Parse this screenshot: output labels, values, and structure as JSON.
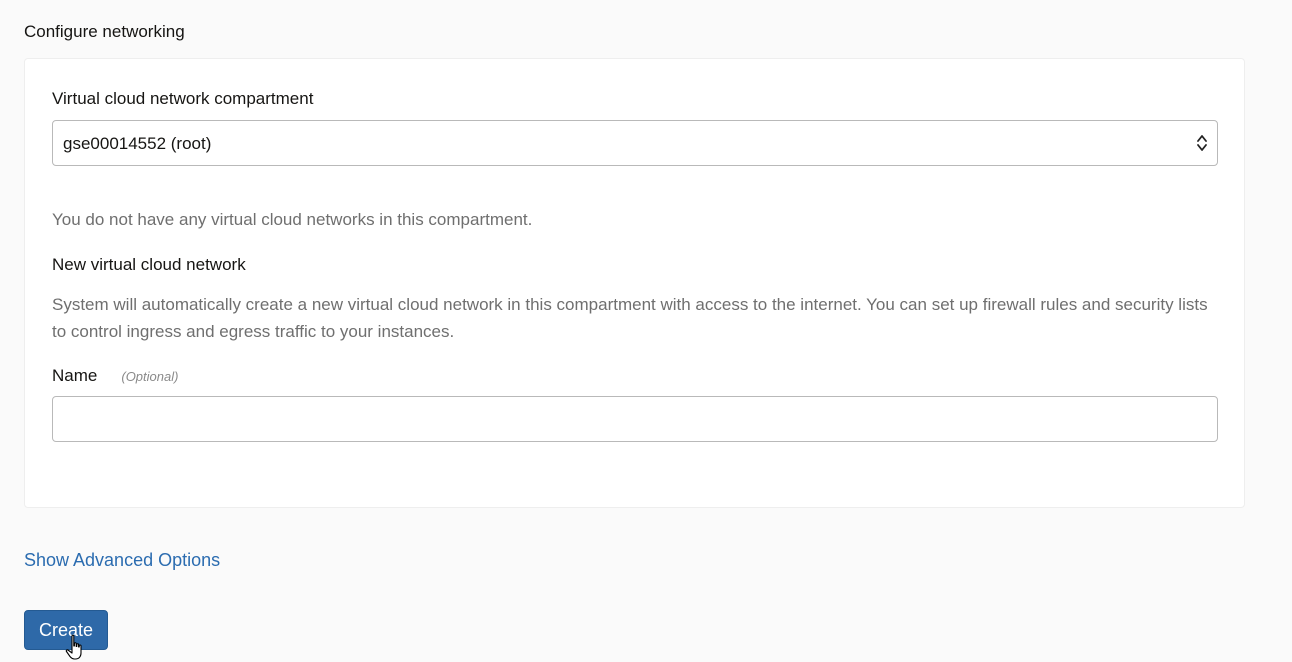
{
  "section": {
    "title": "Configure networking"
  },
  "compartment": {
    "label": "Virtual cloud network compartment",
    "selected_value": "gse00014552 (root)"
  },
  "vcn": {
    "empty_message": "You do not have any virtual cloud networks in this compartment.",
    "new_heading": "New virtual cloud network",
    "description": "System will automatically create a new virtual cloud network in this compartment with access to the internet. You can set up firewall rules and security lists to control ingress and egress traffic to your instances."
  },
  "name_field": {
    "label": "Name",
    "optional_tag": "(Optional)",
    "value": ""
  },
  "actions": {
    "advanced_link": "Show Advanced Options",
    "create_label": "Create"
  },
  "colors": {
    "accent": "#2e69a8",
    "link": "#2b6cb0",
    "muted_text": "#6f6f6f",
    "page_bg": "#fafafa"
  },
  "icons": {
    "select_arrows": "updown-chevron-icon",
    "cursor": "hand-pointer-icon"
  }
}
